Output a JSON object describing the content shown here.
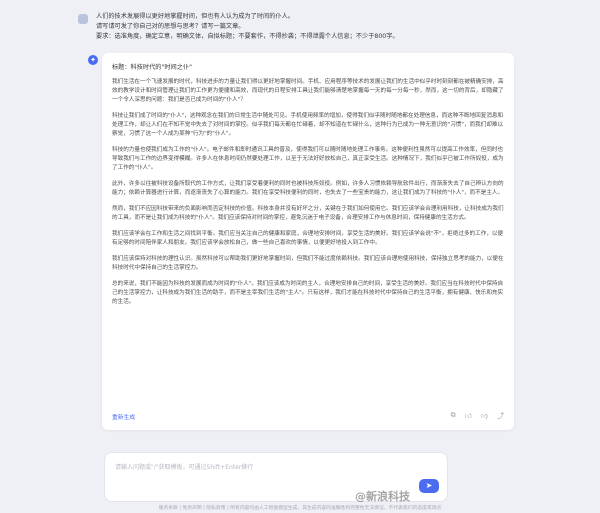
{
  "user_message": {
    "lines": [
      "人们的技术发展得以更好地掌握时间，但也有人认为成为了时间的仆人。",
      "请写请可发了你自己对的思想与思考？请写一篇文章。",
      "要求：选准角度，确定立意，明确文体，自拟标题；不要套作，不得抄袭；不得泄露个人信息；不少于800字。"
    ]
  },
  "answer": {
    "title": "标题：科技时代的\"时间之仆\"",
    "paragraphs": [
      "我们生活在一个飞速发展的时代，科技进步的力量让我们得以更好地掌握时间。手机、应用程序等技术的发展让我们的生活中似乎时时刻刻都在被精确安排，高效的教学设计和时间管理让我们的工作更为便捷和高效，而现代的日程安排工具让我们能够清楚地掌握每一天的每一分每一秒，然而，这一切的背后，却隐藏了一个令人深思的问题：我们是否已成为时间的\"仆人\"？",
      "科技让我们成了时间的\"仆人\"，这种观念在我们的日常生活中随处可见。手机使用频率的增加，使得我们似乎随时随地都在处理信息，而这种不断地回复消息和处理工作，却让人们在不知不觉中失去了对时间的掌控。似乎我们每天都在忙碌着，却不知道在忙碌什么，这种行为已成为一种无意识的\"习惯\"，而我们却难以察觉，习惯了这一个人成为某种\"行为\"的\"仆人\"。",
      "科技的力量也使我们成为工作的\"仆人\"。电子邮件和即时通讯工具的普及，使得我们可以随时随地处理工作事务。这种便利性虽然可以提高工作效率，但同时也导致我们与工作的边界变得模糊。许多人在休息时间仍然要处理工作，以至于无法好好放松自己，真正享受生活。这种情况下，我们似乎已被工作所奴役，成为了工作的\"仆人\"。",
      "此外，许多以往被科技设备所取代的工作方式，让我们享受着便利的同时也被科技所奴役。例如，许多人习惯依赖导航软件出行，而渐渐失去了自己辨认方向的能力；依赖计算器进行计算，而逐渐丧失了心算的能力。我们在享受科技便利的同时，也失去了一些宝贵的能力，这让我们成为了科技的\"仆人\"，而不是主人。",
      "然而，我们不应因科技带来的负面影响而否定科技的价值。科技本身并没有好坏之分，关键在于我们如何使用它。我们应该学会合理利用科技，让科技成为我们的工具，而不是让我们成为科技的\"仆人\"。我们应该保持对时间的掌控，避免沉迷于电子设备，合理安排工作与休息时间，保持健康的生活方式。",
      "我们应该学会在工作和生活之间找到平衡。我们应当关注自己的健康和家庭，合理地安排时间，享受生活的美好。我们应该学会说\"不\"，拒绝过多的工作，以便有足够的时间陪伴家人和朋友。我们应该学会放松自己，做一些自己喜欢的事情，以便更好地投入到工作中。",
      "我们应该保持对科技的理性认识。虽然科技可以帮助我们更好地掌握时间，但我们不能过度依赖科技。我们应该合理地使用科技，保持独立思考的能力，以便在科技时代中保持自己的生活掌控力。",
      "总的来说，我们不能因为科技的发展而成为时间的\"仆人\"。我们应该成为时间的主人，合理地安排自己的时间，享受生活的美好。我们应当在科技时代中保持自己的生活掌控力，让科技成为我们生活的助手，而不是主宰我们生活的\"主人\"。只有这样，我们才能在科技时代中保持自己的生活平衡，拥有健康、快乐和充实的生活。"
    ],
    "regenerate_label": "重新生成"
  },
  "input": {
    "placeholder": "请输入问题或\"/\"获取模板，可通过Shift+Enter换行"
  },
  "footer_note": "服务条款 | 免责声明 | 隐私政策 | 所有内容均由人工智能模型生成，其生成内容的准确性和完整性无法保证，不代表我们的态度或观点",
  "watermark": "@新浪科技",
  "colors": {
    "accent": "#4b6cf0",
    "page_background": "#eef0f6",
    "card_background": "#ffffff"
  }
}
